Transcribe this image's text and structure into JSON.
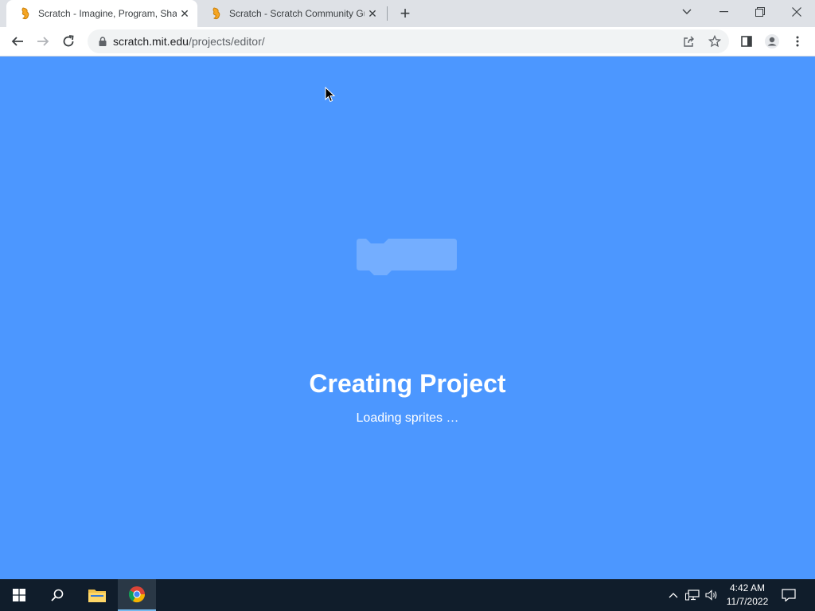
{
  "browser": {
    "tabs": [
      {
        "title": "Scratch - Imagine, Program, Share",
        "favicon": "scratch-cat-icon",
        "active": true
      },
      {
        "title": "Scratch - Scratch Community Guidelines",
        "favicon": "scratch-cat-icon",
        "active": false
      }
    ],
    "url_host": "scratch.mit.edu",
    "url_path": "/projects/editor/"
  },
  "loader": {
    "title": "Creating Project",
    "message": "Loading sprites …"
  },
  "taskbar": {
    "time": "4:42 AM",
    "date": "11/7/2022"
  },
  "colors": {
    "page_background": "#4c97ff",
    "block_color": "#74aeff",
    "tab_strip": "#dee1e6",
    "taskbar": "#101d2b"
  }
}
